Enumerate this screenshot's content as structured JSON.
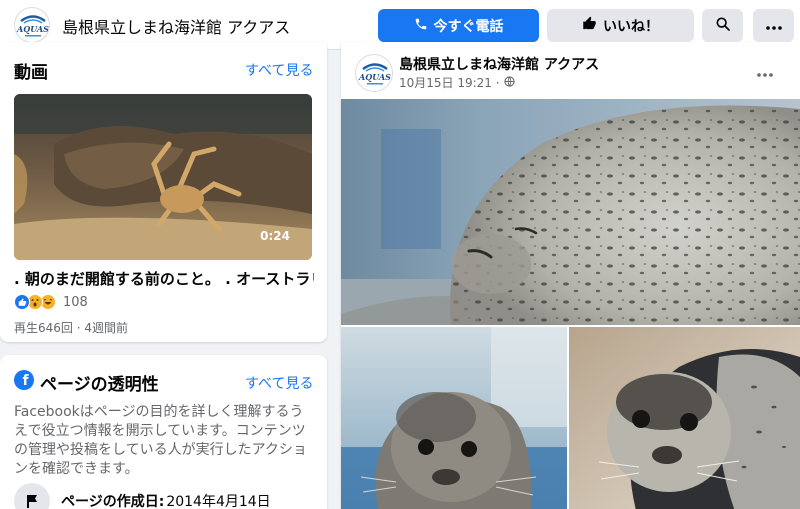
{
  "header": {
    "page_name": "島根県立しまね海洋館 アクアス",
    "call_button": "今すぐ電話",
    "like_button": "いいね！"
  },
  "logo_text": "AQUAS",
  "videos": {
    "title": "動画",
    "see_all": "すべて見る",
    "duration": "0:24",
    "video_title": ". 朝のまだ開館する前のこと。 . オーストラリア",
    "reaction_count": "108",
    "meta": "再生646回 · 4週間前"
  },
  "transparency": {
    "title": "ページの透明性",
    "see_all": "すべて見る",
    "description": "Facebookはページの目的を詳しく理解するうえで役立つ情報を開示しています。コンテンツの管理や投稿をしている人が実行したアクションを確認できます。",
    "created_label": "ページの作成日:",
    "created_value": "2014年4月14日"
  },
  "post": {
    "author": "島根県立しまね海洋館 アクアス",
    "time": "10月15日 19:21 ·"
  },
  "icons": {
    "call": "phone-icon",
    "like": "thumbs-up-icon",
    "search": "search-icon",
    "more": "more-dots-icon",
    "globe": "globe-icon",
    "flag": "flag-icon"
  },
  "colors": {
    "accent": "#1877f2",
    "background": "#f0f2f5",
    "secondary_text": "#65676b"
  }
}
